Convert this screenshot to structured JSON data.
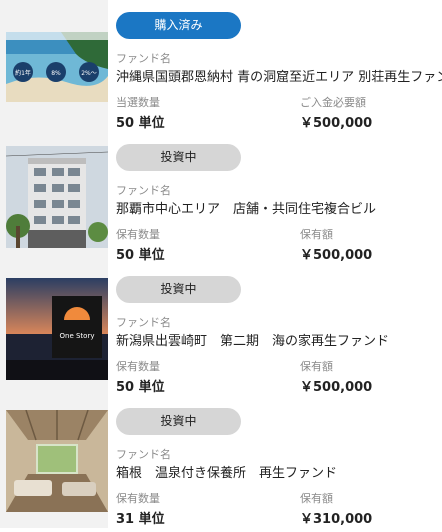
{
  "funds": [
    {
      "status": "購入済み",
      "status_type": "purchased",
      "fund_label": "ファンド名",
      "fund_name": "沖縄県国頭郡恩納村 青の洞窟至近エリア 別荘再生ファンド",
      "left_label": "当選数量",
      "left_value": "50 単位",
      "right_label": "ご入金必要額",
      "right_value": "￥500,000",
      "thumb_texts": [
        "約1年",
        "8%",
        "2%～"
      ]
    },
    {
      "status": "投資中",
      "status_type": "investing",
      "fund_label": "ファンド名",
      "fund_name": "那覇市中心エリア　店舗・共同住宅複合ビル",
      "left_label": "保有数量",
      "left_value": "50 単位",
      "right_label": "保有額",
      "right_value": "￥500,000"
    },
    {
      "status": "投資中",
      "status_type": "investing",
      "fund_label": "ファンド名",
      "fund_name": "新潟県出雲崎町　第二期　海の家再生ファンド",
      "left_label": "保有数量",
      "left_value": "50 単位",
      "right_label": "保有額",
      "right_value": "￥500,000",
      "thumb_texts": [
        "One Story"
      ]
    },
    {
      "status": "投資中",
      "status_type": "investing",
      "fund_label": "ファンド名",
      "fund_name": "箱根　温泉付き保養所　再生ファンド",
      "left_label": "保有数量",
      "left_value": "31 単位",
      "right_label": "保有額",
      "right_value": "￥310,000"
    }
  ],
  "colors": {
    "purchased_badge": "#1b77c4",
    "investing_badge": "#d6d6d6"
  }
}
